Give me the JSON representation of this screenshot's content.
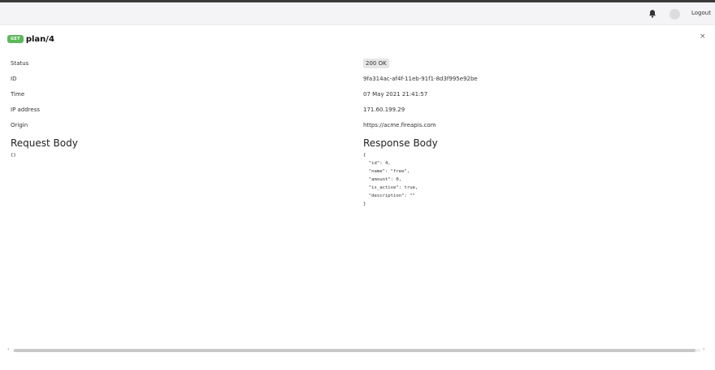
{
  "header": {
    "icons": [
      "bell-icon",
      "avatar"
    ],
    "logout_label": "Logout"
  },
  "request": {
    "method": "GET",
    "path": "plan/4",
    "close_icon": "×"
  },
  "details": [
    {
      "label": "Status",
      "value": "200 OK"
    },
    {
      "label": "ID",
      "value": "9fa314ac-af4f-11eb-91f1-8d3f995e92be"
    },
    {
      "label": "Time",
      "value": "07 May 2021 21:41:57"
    },
    {
      "label": "IP address",
      "value": "171.60.199.29"
    },
    {
      "label": "Origin",
      "value": "https://acme.fireapis.com"
    }
  ],
  "request_body": {
    "title": "Request Body",
    "content": "{}"
  },
  "response_body": {
    "title": "Response Body",
    "content": "{\n  \"id\": 4,\n  \"name\": \"free\",\n  \"amount\": 0,\n  \"is_active\": true,\n  \"description\": \"\"\n}"
  },
  "colors": {
    "method_badge": "#5cb85c",
    "status_badge_bg": "#e6e6e6"
  }
}
